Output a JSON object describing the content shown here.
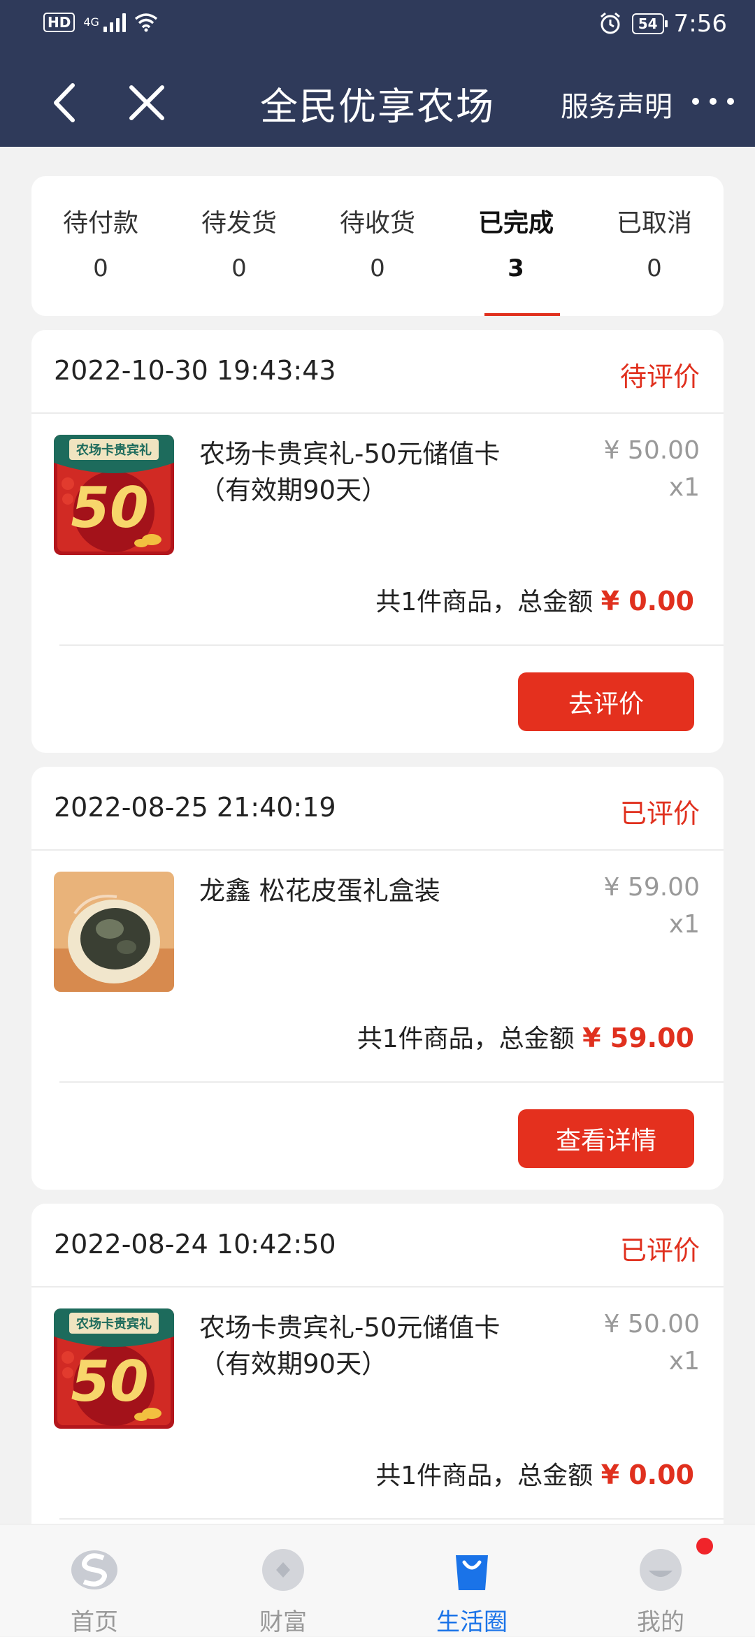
{
  "status_bar": {
    "hd": "HD",
    "network": "4G",
    "battery": "54",
    "time": "7:56"
  },
  "nav": {
    "title": "全民优享农场",
    "service": "服务声明"
  },
  "tabs": [
    {
      "label": "待付款",
      "count": "0"
    },
    {
      "label": "待发货",
      "count": "0"
    },
    {
      "label": "待收货",
      "count": "0"
    },
    {
      "label": "已完成",
      "count": "3",
      "active": true
    },
    {
      "label": "已取消",
      "count": "0"
    }
  ],
  "orders": [
    {
      "date": "2022-10-30 19:43:43",
      "status": "待评价",
      "product": "农场卡贵宾礼-50元储值卡（有效期90天）",
      "price": "¥ 50.00",
      "qty": "x1",
      "summary": "共1件商品，总金额",
      "total": "¥ 0.00",
      "action": "去评价",
      "thumb_top_text": "农场卡贵宾礼",
      "thumb_value": "50"
    },
    {
      "date": "2022-08-25 21:40:19",
      "status": "已评价",
      "product": "龙鑫 松花皮蛋礼盒装",
      "price": "¥ 59.00",
      "qty": "x1",
      "summary": "共1件商品，总金额",
      "total": "¥ 59.00",
      "action": "查看详情"
    },
    {
      "date": "2022-08-24 10:42:50",
      "status": "已评价",
      "product": "农场卡贵宾礼-50元储值卡（有效期90天）",
      "price": "¥ 50.00",
      "qty": "x1",
      "summary": "共1件商品，总金额",
      "total": "¥ 0.00",
      "thumb_top_text": "农场卡贵宾礼",
      "thumb_value": "50"
    }
  ],
  "bottom_nav": [
    {
      "label": "首页"
    },
    {
      "label": "财富"
    },
    {
      "label": "生活圈",
      "active": true
    },
    {
      "label": "我的"
    }
  ],
  "colors": {
    "header": "#2f3a5a",
    "accent": "#e0301e",
    "active_tab": "#1a73e8"
  }
}
